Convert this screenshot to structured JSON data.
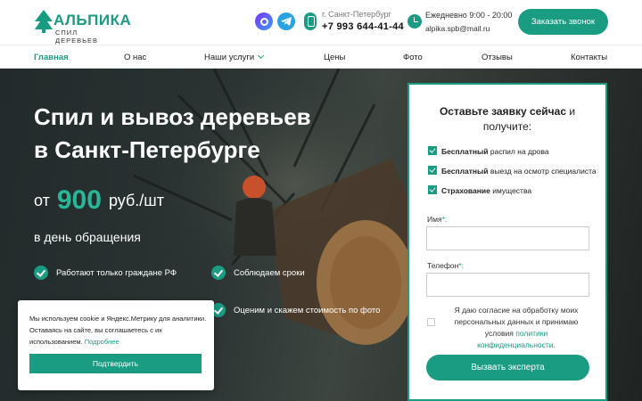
{
  "header": {
    "logo_main": "АЛЬПИКА",
    "logo_sub": "СПИЛ ДЕРЕВЬЕВ",
    "city": "г. Санкт-Петербург",
    "phone": "+7 993 644-41-44",
    "hours": "Ежедневно 9:00 - 20:00",
    "email": "alpika.spb@mail.ru",
    "call_button": "Заказать звонок",
    "icons": [
      "max-messenger-icon",
      "telegram-icon",
      "phone-icon",
      "clock-icon"
    ]
  },
  "nav": {
    "items": [
      {
        "label": "Главная",
        "active": true
      },
      {
        "label": "О нас"
      },
      {
        "label": "Наши услуги"
      },
      {
        "label": "Цены"
      },
      {
        "label": "Фото"
      },
      {
        "label": "Отзывы"
      },
      {
        "label": "Контакты"
      }
    ]
  },
  "hero": {
    "title_line1": "Спил и вывоз деревьев",
    "title_line2": "в Санкт-Петербурге",
    "price_prefix": "от",
    "price_value": "900",
    "price_suffix": "руб./шт",
    "subtitle": "в день обращения",
    "features": [
      "Работают только граждане РФ",
      "Соблюдаем сроки",
      "Оценим и скажем стоимость по фото"
    ]
  },
  "form": {
    "heading_bold": "Оставьте заявку сейчас",
    "heading_rest": "и",
    "heading_line2": "получите:",
    "checks": [
      {
        "bold": "Бесплатный",
        "rest": "распил на дрова"
      },
      {
        "bold": "Бесплатный",
        "rest": "выезд на осмотр специалиста"
      },
      {
        "bold": "Страхование",
        "rest": "имущества"
      }
    ],
    "name_label": "Имя",
    "phone_label": "Телефон",
    "required_mark": "*:",
    "consent_text": "Я даю согласие на обработку моих персональных данных и принимаю условия",
    "consent_link": "политики конфиденциальности",
    "consent_end": ".",
    "submit": "Вызвать эксперта"
  },
  "cookie": {
    "text": "Мы используем cookie и Яндекс.Метрику для аналитики. Оставаясь на сайте, вы соглашаетесь с их использованием.",
    "link": "Подробнее",
    "button": "Подтвердить"
  },
  "colors": {
    "accent": "#1a9c82",
    "accent_light": "#27b899",
    "hero_bg": "#2b3433"
  }
}
